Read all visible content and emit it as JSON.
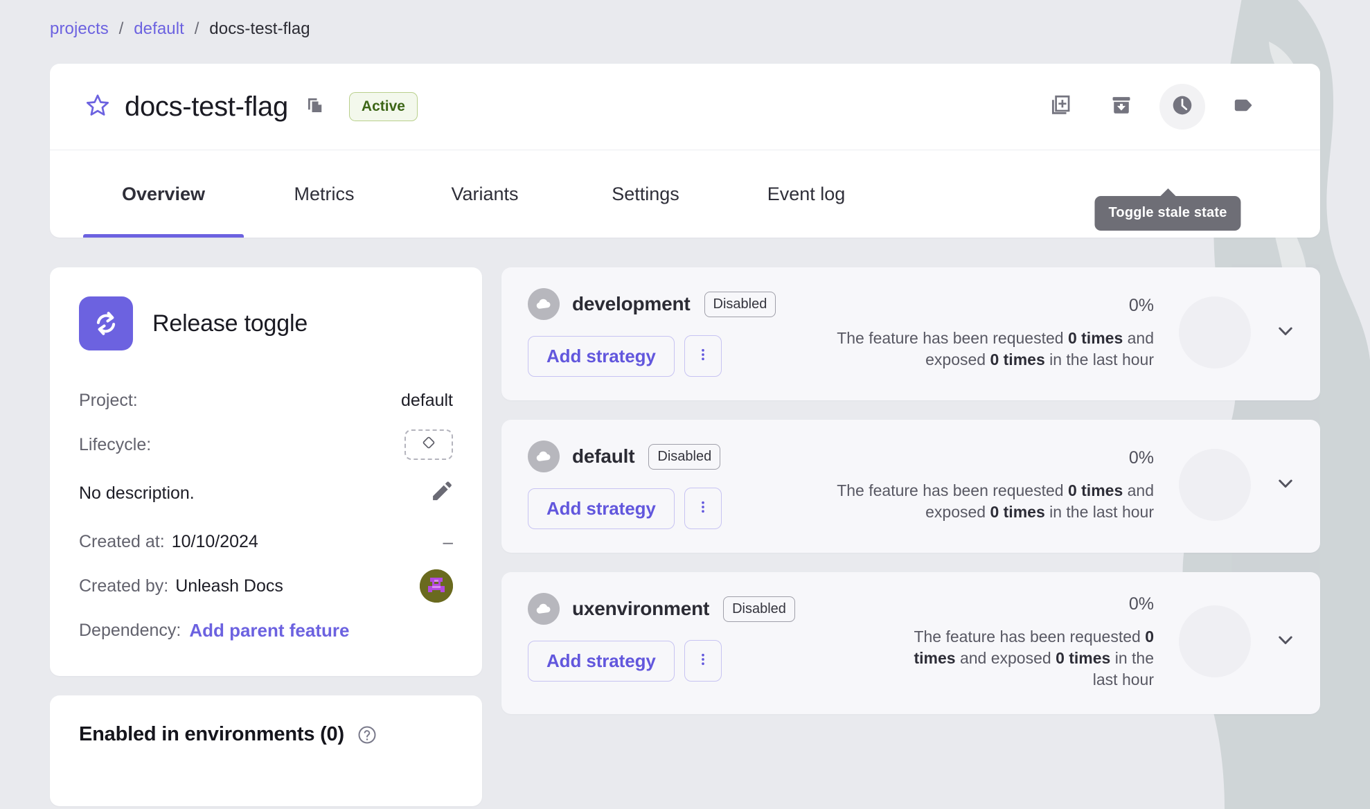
{
  "breadcrumb": {
    "items": [
      "projects",
      "default",
      "docs-test-flag"
    ],
    "separator": "/"
  },
  "header": {
    "title": "docs-test-flag",
    "status_badge": "Active",
    "star_icon": "star-outline-icon",
    "copy_icon": "copy-icon",
    "actions": [
      {
        "name": "add-to-collection",
        "icon": "add-library-icon"
      },
      {
        "name": "archive",
        "icon": "archive-down-icon"
      },
      {
        "name": "toggle-stale-state",
        "icon": "clock-icon",
        "hovered": true
      },
      {
        "name": "add-tag",
        "icon": "tag-icon"
      }
    ],
    "tooltip": "Toggle stale state"
  },
  "tabs": [
    {
      "label": "Overview",
      "active": true
    },
    {
      "label": "Metrics",
      "active": false
    },
    {
      "label": "Variants",
      "active": false
    },
    {
      "label": "Settings",
      "active": false
    },
    {
      "label": "Event log",
      "active": false
    }
  ],
  "info_card": {
    "type_icon": "sync-arrows-icon",
    "type_label": "Release toggle",
    "project_key": "Project:",
    "project_value": "default",
    "lifecycle_key": "Lifecycle:",
    "lifecycle_icon": "diamond-outline-icon",
    "description": "No description.",
    "edit_icon": "pencil-icon",
    "created_at_key": "Created at:",
    "created_at_value": "10/10/2024",
    "created_at_right": "–",
    "created_by_key": "Created by:",
    "created_by_value": "Unleash Docs",
    "avatar_icon": "user-avatar",
    "dependency_key": "Dependency:",
    "dependency_link": "Add parent feature"
  },
  "enabled_card": {
    "title": "Enabled in environments (0)",
    "help_icon": "help-circle-icon"
  },
  "environments": [
    {
      "name": "development",
      "status": "Disabled",
      "add_strategy_label": "Add strategy",
      "kebab_icon": "more-vertical-icon",
      "percent": "0%",
      "metrics_prefix": "The feature has been requested ",
      "metrics_requested": "0 times",
      "metrics_middle": " and exposed ",
      "metrics_exposed": "0 times",
      "metrics_suffix": " in the last hour",
      "cloud_icon": "cloud-icon",
      "chevron_icon": "chevron-down-icon",
      "narrow": false
    },
    {
      "name": "default",
      "status": "Disabled",
      "add_strategy_label": "Add strategy",
      "kebab_icon": "more-vertical-icon",
      "percent": "0%",
      "metrics_prefix": "The feature has been requested ",
      "metrics_requested": "0 times",
      "metrics_middle": " and exposed ",
      "metrics_exposed": "0 times",
      "metrics_suffix": " in the last hour",
      "cloud_icon": "cloud-icon",
      "chevron_icon": "chevron-down-icon",
      "narrow": false
    },
    {
      "name": "uxenvironment",
      "status": "Disabled",
      "add_strategy_label": "Add strategy",
      "kebab_icon": "more-vertical-icon",
      "percent": "0%",
      "metrics_prefix": "The feature has been requested ",
      "metrics_requested": "0 times",
      "metrics_middle": " and exposed ",
      "metrics_exposed": "0 times",
      "metrics_suffix": " in the last hour",
      "cloud_icon": "cloud-icon",
      "chevron_icon": "chevron-down-icon",
      "narrow": true
    }
  ],
  "colors": {
    "accent": "#6c62e0",
    "page_bg": "#e9eaee",
    "card_bg": "#ffffff",
    "env_card_bg": "#f7f7fa",
    "badge_green_text": "#3d6617",
    "badge_green_bg": "#f3f8ec",
    "tooltip_bg": "#6e6e76",
    "muted_text": "#62626d"
  }
}
